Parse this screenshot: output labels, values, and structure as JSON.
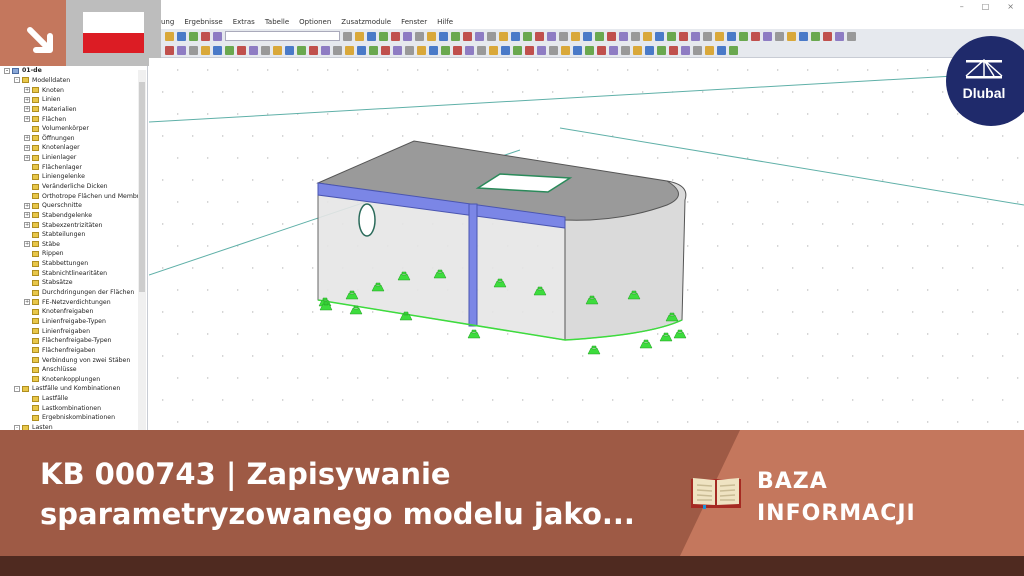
{
  "flag": {
    "country": "Poland",
    "colors": [
      "#ffffff",
      "#dc1c24"
    ]
  },
  "window": {
    "controls": [
      "–",
      "□",
      "×"
    ]
  },
  "menu": [
    "ung",
    "Ergebnisse",
    "Extras",
    "Tabelle",
    "Optionen",
    "Zusatzmodule",
    "Fenster",
    "Hilfe"
  ],
  "tree": {
    "root": "01-de",
    "items": [
      {
        "label": "Modelldaten",
        "level": 1,
        "expand": true
      },
      {
        "label": "Knoten",
        "level": 2,
        "expand": true
      },
      {
        "label": "Linien",
        "level": 2,
        "expand": true
      },
      {
        "label": "Materialien",
        "level": 2,
        "expand": true
      },
      {
        "label": "Flächen",
        "level": 2,
        "expand": true
      },
      {
        "label": "Volumenkörper",
        "level": 2
      },
      {
        "label": "Öffnungen",
        "level": 2,
        "expand": true
      },
      {
        "label": "Knotenlager",
        "level": 2,
        "expand": true
      },
      {
        "label": "Linienlager",
        "level": 2,
        "expand": true
      },
      {
        "label": "Flächenlager",
        "level": 2
      },
      {
        "label": "Liniengelenke",
        "level": 2
      },
      {
        "label": "Veränderliche Dicken",
        "level": 2
      },
      {
        "label": "Orthotrope Flächen und Membr...",
        "level": 2
      },
      {
        "label": "Querschnitte",
        "level": 2,
        "expand": true
      },
      {
        "label": "Stabendgelenke",
        "level": 2,
        "expand": true
      },
      {
        "label": "Stabexzentrizitäten",
        "level": 2,
        "expand": true
      },
      {
        "label": "Stabteilungen",
        "level": 2
      },
      {
        "label": "Stäbe",
        "level": 2,
        "expand": true
      },
      {
        "label": "Rippen",
        "level": 2
      },
      {
        "label": "Stabbettungen",
        "level": 2
      },
      {
        "label": "Stabnichtlinearitäten",
        "level": 2
      },
      {
        "label": "Stabsätze",
        "level": 2
      },
      {
        "label": "Durchdringungen der Flächen",
        "level": 2
      },
      {
        "label": "FE-Netzverdichtungen",
        "level": 2,
        "expand": true
      },
      {
        "label": "Knotenfreigaben",
        "level": 2
      },
      {
        "label": "Linienfreigabe-Typen",
        "level": 2
      },
      {
        "label": "Linienfreigaben",
        "level": 2
      },
      {
        "label": "Flächenfreigabe-Typen",
        "level": 2
      },
      {
        "label": "Flächenfreigaben",
        "level": 2
      },
      {
        "label": "Verbindung von zwei Stäben",
        "level": 2
      },
      {
        "label": "Anschlüsse",
        "level": 2
      },
      {
        "label": "Knotenkopplungen",
        "level": 2
      },
      {
        "label": "Lastfälle und Kombinationen",
        "level": 1,
        "expand": true
      },
      {
        "label": "Lastfälle",
        "level": 2
      },
      {
        "label": "Lastkombinationen",
        "level": 2
      },
      {
        "label": "Ergebniskombinationen",
        "level": 2
      },
      {
        "label": "Lasten",
        "level": 1,
        "expand": true
      }
    ]
  },
  "logo": {
    "text": "Dlubal"
  },
  "banner": {
    "title_line1": "KB 000743 | Zapisywanie",
    "title_line2": "sparametryzowanego modelu jako...",
    "category_line1": "BAZA",
    "category_line2": "INFORMACJI"
  },
  "colors": {
    "accent": "#c4775d",
    "banner_dark": "#9e5a45",
    "footer": "#4f2a20",
    "member": "#7b86e6",
    "support": "#3ddc3d",
    "logo": "#1f2a6b"
  }
}
